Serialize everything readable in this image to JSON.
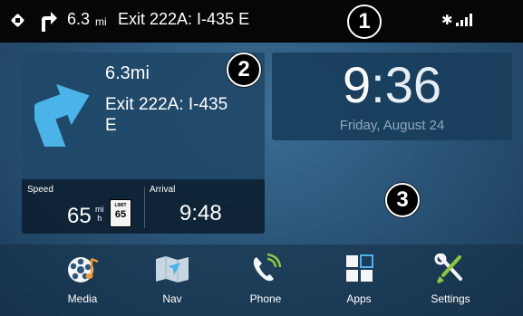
{
  "status_bar": {
    "distance": "6.3",
    "unit": "mi",
    "exit": "Exit 222A: I-435 E",
    "icons": [
      "direction-diamond-icon",
      "turn-right-icon",
      "bluetooth-icon",
      "signal-icon"
    ]
  },
  "callouts": [
    "1",
    "2",
    "3"
  ],
  "nav": {
    "distance": "6.3mi",
    "exit_line1": "Exit 222A: I-435",
    "exit_line2": "E",
    "speed_label": "Speed",
    "speed_value": "65",
    "speed_unit_top": "mi",
    "speed_unit_bottom": "h",
    "limit_label": "LIMIT",
    "limit_value": "65",
    "arrival_label": "Arrival",
    "arrival_value": "9:48"
  },
  "clock": {
    "hour": "9",
    "colon_minutes": ":36",
    "date": "Friday, August 24"
  },
  "dock": [
    {
      "label": "Media",
      "icon": "media-icon"
    },
    {
      "label": "Nav",
      "icon": "nav-map-icon"
    },
    {
      "label": "Phone",
      "icon": "phone-icon"
    },
    {
      "label": "Apps",
      "icon": "apps-grid-icon"
    },
    {
      "label": "Settings",
      "icon": "settings-tools-icon"
    }
  ],
  "colors": {
    "accent_blue": "#4ab3e8",
    "background": "#2b5679",
    "status_bar": "#050607",
    "media_orange": "#f29a2e",
    "settings_green": "#8cc63f"
  }
}
